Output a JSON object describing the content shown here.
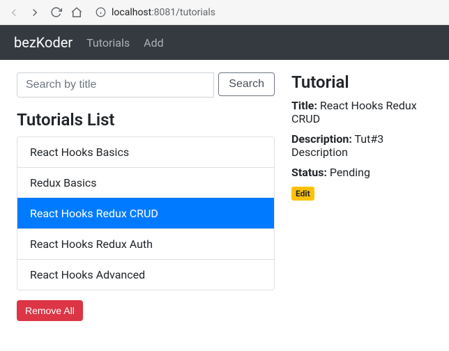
{
  "browser": {
    "url_host": "localhost",
    "url_port_path": ":8081/tutorials"
  },
  "navbar": {
    "brand": "bezKoder",
    "links": [
      "Tutorials",
      "Add"
    ]
  },
  "search": {
    "placeholder": "Search by title",
    "button": "Search"
  },
  "list": {
    "heading": "Tutorials List",
    "items": [
      "React Hooks Basics",
      "Redux Basics",
      "React Hooks Redux CRUD",
      "React Hooks Redux Auth",
      "React Hooks Advanced"
    ],
    "activeIndex": 2,
    "removeAll": "Remove All"
  },
  "detail": {
    "heading": "Tutorial",
    "titleLabel": "Title:",
    "titleValue": "React Hooks Redux CRUD",
    "descLabel": "Description:",
    "descValue": "Tut#3 Description",
    "statusLabel": "Status:",
    "statusValue": "Pending",
    "editLabel": "Edit"
  }
}
